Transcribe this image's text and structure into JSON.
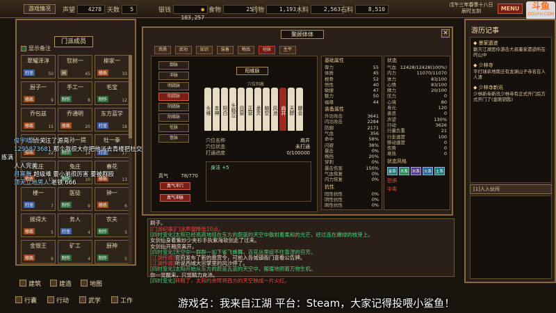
{
  "topbar": {
    "sect_name": "游戏情况",
    "fame_label": "声望",
    "fame_value": "4278",
    "days_label": "天数",
    "days_value": "5",
    "silver_label": "银钱",
    "silver_value": "103,257",
    "food_label": "食物",
    "food_value": "25",
    "medicine_label": "药物",
    "medicine_value": "1,193",
    "wood_label": "木料",
    "wood_value": "2,563",
    "stone_label": "石料",
    "stone_value": "8,510",
    "date": "戊午三年春季十八日",
    "time": "辰时五刻",
    "menu_label": "MENU"
  },
  "watermark": {
    "brand": "斗鱼",
    "url": "DOUYU.COM"
  },
  "left_panel": {
    "show_tip_label": "显示备注",
    "title": "门派成员",
    "members": [
      {
        "name": "翠耀泽淳",
        "tag": "打坐",
        "tag_color": "#3d5fa0",
        "lv": "50"
      },
      {
        "name": "钦树一",
        "tag": "闲",
        "tag_color": "#6a5a3a",
        "lv": "45"
      },
      {
        "name": "柳家一",
        "tag": "修练",
        "tag_color": "#9a4a1e",
        "lv": "33"
      },
      {
        "name": "厨子一",
        "tag": "修练",
        "tag_color": "#9a4a1e",
        "lv": "9"
      },
      {
        "name": "手工一",
        "tag": "制作",
        "tag_color": "#2e6a3a",
        "lv": "8"
      },
      {
        "name": "毛宝",
        "tag": "制作",
        "tag_color": "#2e6a3a",
        "lv": "12"
      },
      {
        "name": "乔包兹",
        "tag": "修练",
        "tag_color": "#9a4a1e",
        "lv": "15"
      },
      {
        "name": "乔通明",
        "tag": "修练",
        "tag_color": "#9a4a1e",
        "lv": "20"
      },
      {
        "name": "东方蓝学",
        "tag": "打坐",
        "tag_color": "#3d5fa0",
        "lv": "18"
      },
      {
        "name": "张一剑",
        "tag": "修练",
        "tag_color": "#9a4a1e",
        "lv": "22"
      },
      {
        "name": "长孙一提",
        "tag": "制作",
        "tag_color": "#2e6a3a",
        "lv": "14"
      },
      {
        "name": "杜一拳",
        "tag": "打坐",
        "tag_color": "#3d5fa0",
        "lv": "17"
      },
      {
        "name": "庄庄",
        "tag": "修练",
        "tag_color": "#9a4a1e",
        "lv": "11"
      },
      {
        "name": "兔庄",
        "tag": "制作",
        "tag_color": "#2e6a3a",
        "lv": "10"
      },
      {
        "name": "春花",
        "tag": "修练",
        "tag_color": "#9a4a1e",
        "lv": "13"
      },
      {
        "name": "楼一",
        "tag": "打坐",
        "tag_color": "#3d5fa0",
        "lv": "7"
      },
      {
        "name": "医徒",
        "tag": "制作",
        "tag_color": "#2e6a3a",
        "lv": "9"
      },
      {
        "name": "钟一",
        "tag": "修练",
        "tag_color": "#9a4a1e",
        "lv": "6"
      },
      {
        "name": "拨得大",
        "tag": "修练",
        "tag_color": "#9a4a1e",
        "lv": "5"
      },
      {
        "name": "务人",
        "tag": "打坐",
        "tag_color": "#3d5fa0",
        "lv": "4"
      },
      {
        "name": "农夫",
        "tag": "制作",
        "tag_color": "#2e6a3a",
        "lv": "3"
      },
      {
        "name": "金银王",
        "tag": "修练",
        "tag_color": "#9a4a1e",
        "lv": "6"
      },
      {
        "name": "矿工",
        "tag": "制作",
        "tag_color": "#2e6a3a",
        "lv": "4"
      },
      {
        "name": "厨神",
        "tag": "制作",
        "tag_color": "#2e6a3a",
        "lv": "5"
      }
    ]
  },
  "chat": [
    {
      "user": "俊宇晴",
      "msg": "点关注了源亮"
    },
    {
      "user": "1295873681",
      "msg": "那个我很大你把他派去青楼把杜交可以"
    },
    {
      "user": "",
      "msg": "练满"
    },
    {
      "user": "",
      "msg": "人人完美"
    },
    {
      "user": "月寒舞",
      "msg": "超级难 要小弟很厉害 要被群殴"
    },
    {
      "user": "顶天立地男人",
      "msg": "老铁 666"
    }
  ],
  "center": {
    "title": "聚顾体体",
    "tabs": [
      "资质",
      "武功",
      "知识",
      "装备",
      "物品",
      "经脉",
      "生平"
    ],
    "active_tab": 5,
    "stances": [
      "御脉",
      "冲脉",
      "明跷脉",
      "阳跷脉",
      "阴跷脉",
      "阳维脉",
      "任脉",
      "督脉"
    ],
    "active_stance": 3,
    "meridian_name": "阳维脉",
    "acu_list_label": "穴位列表",
    "acupoints": [
      "头维",
      "本神",
      "阳白",
      "头临泣",
      "目窗",
      "正营",
      "承灵",
      "脑空",
      "风池",
      "肩井",
      "天髎",
      "臑会"
    ],
    "acu_fields": [
      {
        "k": "穴位名称",
        "v": "肩井"
      },
      {
        "k": "穴位状态",
        "v": "未打通"
      },
      {
        "k": "打通进度",
        "v": "0/100000"
      }
    ],
    "effect_text": "身法 +5",
    "qi_label": "真气",
    "qi_value": "78/770",
    "btn_charge": "真气冲穴",
    "btn_clear": "真气冲脉",
    "base_title": "基础属性",
    "base_stats": [
      {
        "k": "膂力",
        "v": "55"
      },
      {
        "k": "体质",
        "v": "45"
      },
      {
        "k": "根骨",
        "v": "52"
      },
      {
        "k": "悟性",
        "v": "40"
      },
      {
        "k": "敏捷",
        "v": "47"
      },
      {
        "k": "魅力",
        "v": "50"
      },
      {
        "k": "福缘",
        "v": "44"
      }
    ],
    "equip_title": "装备属性",
    "equip_stats": [
      {
        "k": "外功攻击",
        "v": "3641"
      },
      {
        "k": "内功攻击",
        "v": "2284"
      },
      {
        "k": "防御",
        "v": "2171"
      },
      {
        "k": "气血",
        "v": "356"
      },
      {
        "k": "命中",
        "v": "58%"
      },
      {
        "k": "闪避",
        "v": "38%"
      },
      {
        "k": "暴击",
        "v": "0%"
      },
      {
        "k": "格挡",
        "v": "20%"
      },
      {
        "k": "穿刺",
        "v": "0%"
      },
      {
        "k": "暴击伤害",
        "v": "150%"
      },
      {
        "k": "气血恢复",
        "v": "0%"
      },
      {
        "k": "内力恢复",
        "v": "0%"
      }
    ],
    "resist_title": "抗性",
    "resist_stats": [
      {
        "k": "阳性抗性",
        "v": "0%"
      },
      {
        "k": "阴性抗性",
        "v": "0%"
      },
      {
        "k": "刚性抗性",
        "v": "0%"
      },
      {
        "k": "柔性抗性",
        "v": "0%"
      },
      {
        "k": "毒性抗性",
        "v": "0%"
      },
      {
        "k": "混元抗性",
        "v": "0%"
      }
    ],
    "status_title": "状态",
    "status_stats": [
      {
        "k": "气血",
        "v": "12428/12428(100%)"
      },
      {
        "k": "内力",
        "v": "11070/11070"
      },
      {
        "k": "体力",
        "v": "83/100"
      },
      {
        "k": "心情",
        "v": "83/100"
      },
      {
        "k": "精力",
        "v": "20/100"
      },
      {
        "k": "压力",
        "v": "0"
      },
      {
        "k": "心境",
        "v": "80"
      },
      {
        "k": "寿元",
        "v": "120"
      },
      {
        "k": "善恶",
        "v": "0"
      },
      {
        "k": "声望",
        "v": "130%"
      },
      {
        "k": "行动",
        "v": "3626"
      },
      {
        "k": "行囊负重",
        "v": "21"
      },
      {
        "k": "行走速度",
        "v": "100"
      },
      {
        "k": "移动速度",
        "v": "0"
      },
      {
        "k": "伤势",
        "v": "0"
      },
      {
        "k": "寒热",
        "v": "0"
      }
    ],
    "style_title": "状态风格",
    "skill_chips": [
      "金系",
      "木系",
      "水系",
      "火系",
      "土系"
    ],
    "fear_label": "恐惧",
    "ill_label": "中毒"
  },
  "log": {
    "speaker": "刷子。",
    "lines": [
      {
        "tag": "[门派纪事]",
        "tag_color": "#e34d3a",
        "text": "门派声望降低10点。",
        "color": "#e34d3a"
      },
      {
        "tag": "[四时变化]",
        "tag_color": "#4cd07a",
        "text": "太阳已经高高地挂在东方的蔚蓝的天空中散射着柔和的光芒，经过连在嫩绿的枝芽上。",
        "color": "#4cd07a"
      },
      {
        "tag": "",
        "tag_color": "",
        "text": "女剑仙身着紫纱少夹衫手执紫海软剑走了过来。",
        "color": "#e8e0cc"
      },
      {
        "tag": "",
        "tag_color": "",
        "text": "女剑仙开厢房离开。",
        "color": "#e8e0cc"
      },
      {
        "tag": "[四时变化]",
        "tag_color": "#4cd07a",
        "text": "天空中一群群一如下雀飞蜂舞，百花丛里绽不住香涅的芬芳。",
        "color": "#4cd07a"
      },
      {
        "tag": "[江湖传闻]",
        "tag_color": "#e34d3a",
        "text": "官府发布了新的悬赏令，可前入各城镇衙门查看公告牌。",
        "color": "#e8e0cc"
      },
      {
        "tag": "[江湖传闻]",
        "tag_color": "#e34d3a",
        "text": "听说西域大宗掌里的风沙停了。",
        "color": "#e8e0cc"
      },
      {
        "tag": "[四时变化]",
        "tag_color": "#4cd07a",
        "text": "太阳开始从东方的蔚蓝瓦蓝的天空中，暖暖地照着万物生机。",
        "color": "#4cd07a"
      },
      {
        "tag": "",
        "tag_color": "",
        "text": "你一觉醒来，只觉精力充沛。",
        "color": "#e8e0cc"
      },
      {
        "tag": "[四时变化]",
        "tag_color": "#4cd07a",
        "text": "转眼了，太阳的余晖将西方的天空映成一片火红。",
        "color": "#e34d3a"
      }
    ]
  },
  "right_panel": {
    "title": "游历记事",
    "items": [
      {
        "title": "墨家遗迹",
        "body": "剿灭江湖恶伶游击大叔墨家遗迹所在的山中"
      },
      {
        "title": "少林寺",
        "body": "平打球杀地南迁有龙渊山子寺名在人人清"
      },
      {
        "title": "少林寺新讯",
        "body": "少林新寺新讯少林寺有正式开门后方式开门了(金刚钥匙)"
      }
    ],
    "list_label": "[1]人入伙间"
  },
  "nav": {
    "row1": [
      "建筑",
      "建造",
      "地图"
    ],
    "row2": [
      "行囊",
      "行动",
      "武学",
      "工作"
    ]
  },
  "caption": "游戏名：我来自江湖 平台：Steam，大家记得投喂小鲨鱼！"
}
